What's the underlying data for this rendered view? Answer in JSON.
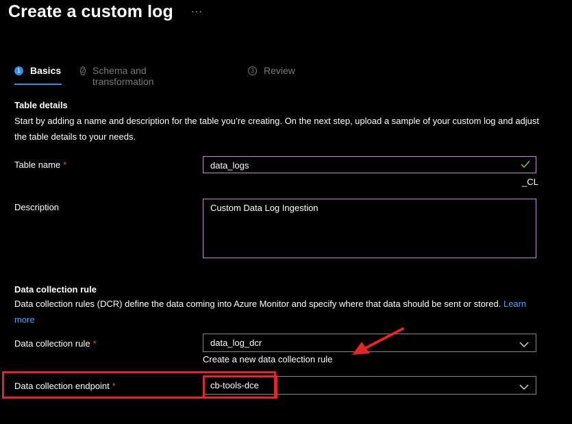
{
  "header": {
    "title": "Create a custom log",
    "more": "···"
  },
  "tabs": [
    {
      "number": "1",
      "label": "Basics"
    },
    {
      "number": "2",
      "label": "Schema and transformation"
    },
    {
      "number": "3",
      "label": "Review"
    }
  ],
  "table_details": {
    "title": "Table details",
    "description": "Start by adding a name and description for the table you’re creating. On the next step, upload a sample of your custom log and adjust the table details to your needs.",
    "table_name_label": "Table name",
    "required_mark": "*",
    "table_name_value": "data_logs",
    "table_suffix": "_CL",
    "description_label": "Description",
    "description_value": "Custom Data Log Ingestion"
  },
  "dcr": {
    "title": "Data collection rule",
    "description": "Data collection rules (DCR) define the data coming into Azure Monitor and specify where that data should be sent or stored.",
    "learn_more": "Learn more",
    "rule_label": "Data collection rule",
    "rule_value": "data_log_dcr",
    "create_link": "Create a new data collection rule",
    "endpoint_label": "Data collection endpoint",
    "endpoint_value": "cb-tools-dce"
  },
  "colors": {
    "background": "#000000",
    "accent": "#3a8ee6",
    "link": "#4ea2f0",
    "field_border": "#c68ad2",
    "required": "#e74c4c",
    "highlight": "#e0262b",
    "valid": "#6cc24a"
  }
}
